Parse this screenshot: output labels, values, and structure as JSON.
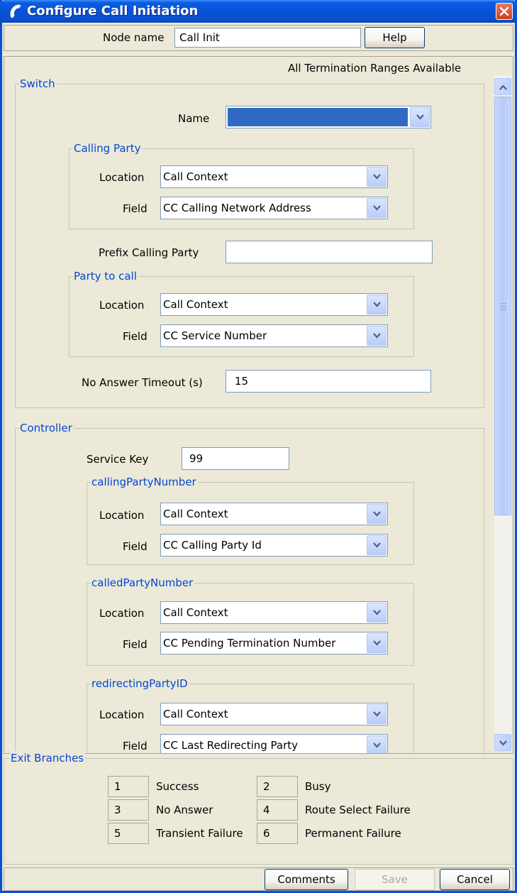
{
  "window": {
    "title": "Configure Call Initiation"
  },
  "topbar": {
    "node_name_label": "Node name",
    "node_name_value": "Call Init",
    "help_label": "Help"
  },
  "content": {
    "status_text": "All Termination Ranges Available",
    "switch": {
      "legend": "Switch",
      "name_label": "Name",
      "name_value": "",
      "calling_party": {
        "legend": "Calling Party",
        "location_label": "Location",
        "location_value": "Call Context",
        "field_label": "Field",
        "field_value": "CC Calling Network Address"
      },
      "prefix_label": "Prefix Calling Party",
      "prefix_value": "",
      "party_to_call": {
        "legend": "Party to call",
        "location_label": "Location",
        "location_value": "Call Context",
        "field_label": "Field",
        "field_value": "CC Service Number"
      },
      "timeout_label": "No Answer Timeout (s)",
      "timeout_value": "15"
    },
    "controller": {
      "legend": "Controller",
      "service_key_label": "Service Key",
      "service_key_value": "99",
      "calling_party_number": {
        "legend": "callingPartyNumber",
        "location_label": "Location",
        "location_value": "Call Context",
        "field_label": "Field",
        "field_value": "CC Calling Party Id"
      },
      "called_party_number": {
        "legend": "calledPartyNumber",
        "location_label": "Location",
        "location_value": "Call Context",
        "field_label": "Field",
        "field_value": "CC Pending Termination Number"
      },
      "redirecting_party_id": {
        "legend": "redirectingPartyID",
        "location_label": "Location",
        "location_value": "Call Context",
        "field_label": "Field",
        "field_value": "CC Last Redirecting Party"
      }
    }
  },
  "exit_branches": {
    "legend": "Exit Branches",
    "items": [
      {
        "num": "1",
        "label": "Success"
      },
      {
        "num": "2",
        "label": "Busy"
      },
      {
        "num": "3",
        "label": "No Answer"
      },
      {
        "num": "4",
        "label": "Route Select Failure"
      },
      {
        "num": "5",
        "label": "Transient Failure"
      },
      {
        "num": "6",
        "label": "Permanent Failure"
      }
    ]
  },
  "buttons": {
    "comments": "Comments",
    "save": "Save",
    "cancel": "Cancel"
  }
}
